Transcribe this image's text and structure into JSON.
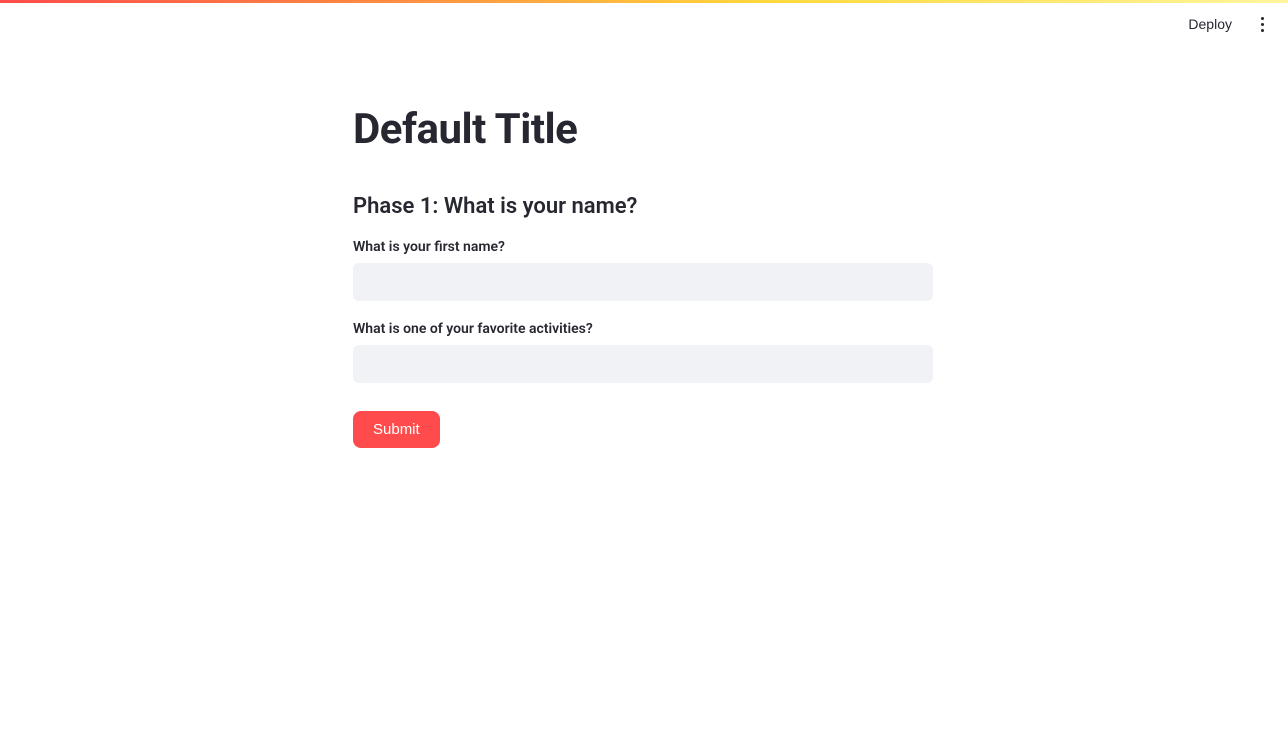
{
  "header": {
    "deploy_label": "Deploy"
  },
  "main": {
    "title": "Default Title",
    "section_heading": "Phase 1: What is your name?",
    "fields": [
      {
        "label": "What is your first name?",
        "value": ""
      },
      {
        "label": "What is one of your favorite activities?",
        "value": ""
      }
    ],
    "submit_label": "Submit"
  }
}
